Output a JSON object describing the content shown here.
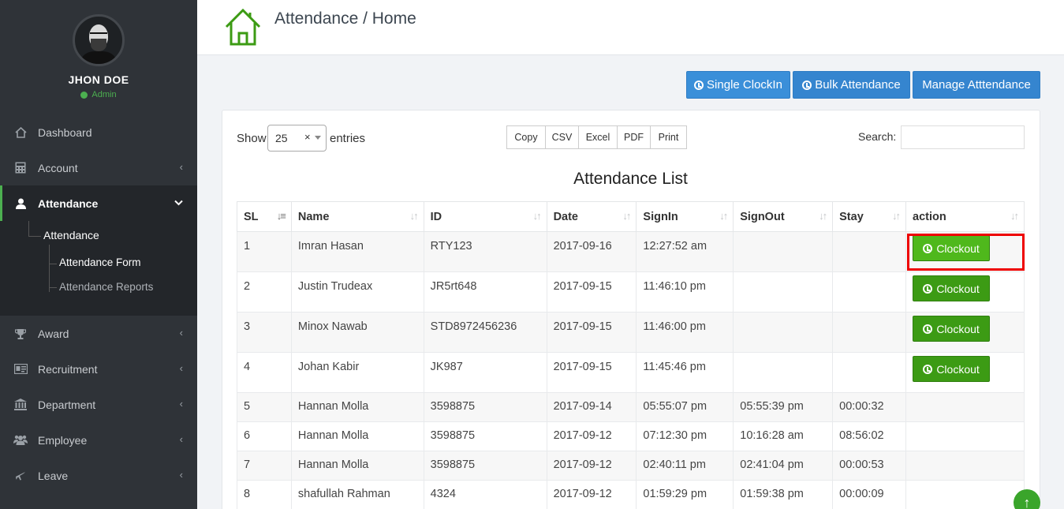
{
  "profile": {
    "name": "JHON DOE",
    "role": "Admin"
  },
  "sidebar": {
    "items": [
      {
        "label": "Dashboard",
        "icon": "home-icon"
      },
      {
        "label": "Account",
        "icon": "calculator-icon"
      },
      {
        "label": "Attendance",
        "icon": "user-icon"
      },
      {
        "label": "Award",
        "icon": "trophy-icon"
      },
      {
        "label": "Recruitment",
        "icon": "id-card-icon"
      },
      {
        "label": "Department",
        "icon": "bank-icon"
      },
      {
        "label": "Employee",
        "icon": "users-icon"
      },
      {
        "label": "Leave",
        "icon": "plane-icon"
      }
    ],
    "submenu": {
      "parent": "Attendance",
      "children": [
        "Attendance Form",
        "Attendance Reports"
      ]
    }
  },
  "header": {
    "title": "Attendance / Home"
  },
  "actions": {
    "single_clockin": "Single ClockIn",
    "bulk_attendance": "Bulk Attendance",
    "manage_attendance": "Manage Atttendance"
  },
  "controls": {
    "show_label": "Show",
    "entries_value": "25",
    "entries_label": "entries",
    "export_buttons": [
      "Copy",
      "CSV",
      "Excel",
      "PDF",
      "Print"
    ],
    "search_label": "Search:"
  },
  "table": {
    "title": "Attendance List",
    "columns": [
      "SL",
      "Name",
      "ID",
      "Date",
      "SignIn",
      "SignOut",
      "Stay",
      "action"
    ],
    "action_label": "Clockout",
    "rows": [
      [
        "1",
        "Imran Hasan",
        "RTY123",
        "2017-09-16",
        "12:27:52 am",
        "",
        "",
        "Clockout"
      ],
      [
        "2",
        "Justin Trudeax",
        "JR5rt648",
        "2017-09-15",
        "11:46:10 pm",
        "",
        "",
        "Clockout"
      ],
      [
        "3",
        "Minox Nawab",
        "STD8972456236",
        "2017-09-15",
        "11:46:00 pm",
        "",
        "",
        "Clockout"
      ],
      [
        "4",
        "Johan Kabir",
        "JK987",
        "2017-09-15",
        "11:45:46 pm",
        "",
        "",
        "Clockout"
      ],
      [
        "5",
        "Hannan Molla",
        "3598875",
        "2017-09-14",
        "05:55:07 pm",
        "05:55:39 pm",
        "00:00:32",
        ""
      ],
      [
        "6",
        "Hannan Molla",
        "3598875",
        "2017-09-12",
        "07:12:30 pm",
        "10:16:28 am",
        "08:56:02",
        ""
      ],
      [
        "7",
        "Hannan Molla",
        "3598875",
        "2017-09-12",
        "02:40:11 pm",
        "02:41:04 pm",
        "00:00:53",
        ""
      ],
      [
        "8",
        "shafullah Rahman",
        "4324",
        "2017-09-12",
        "01:59:29 pm",
        "01:59:38 pm",
        "00:00:09",
        ""
      ]
    ]
  },
  "colors": {
    "accent_green": "#3c9b14",
    "primary_blue": "#3a8fd9",
    "sidebar_bg": "#2f3338"
  }
}
